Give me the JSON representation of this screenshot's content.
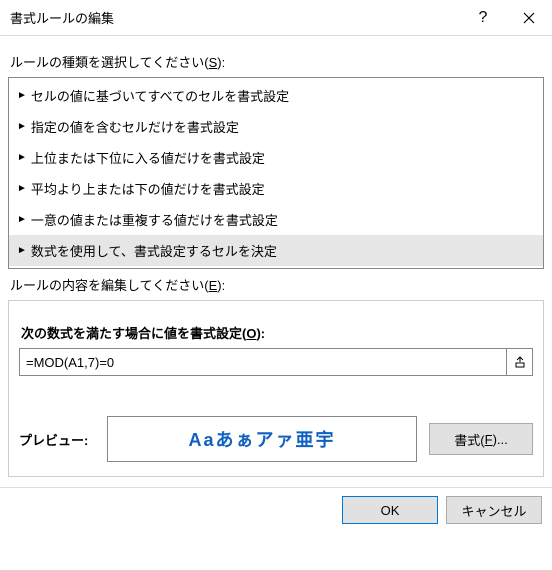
{
  "title": "書式ルールの編集",
  "help_symbol": "?",
  "select_label_pre": "ルールの種類を選択してください(",
  "select_label_key": "S",
  "select_label_post": "):",
  "rules": [
    {
      "label": "セルの値に基づいてすべてのセルを書式設定",
      "selected": false
    },
    {
      "label": "指定の値を含むセルだけを書式設定",
      "selected": false
    },
    {
      "label": "上位または下位に入る値だけを書式設定",
      "selected": false
    },
    {
      "label": "平均より上または下の値だけを書式設定",
      "selected": false
    },
    {
      "label": "一意の値または重複する値だけを書式設定",
      "selected": false
    },
    {
      "label": "数式を使用して、書式設定するセルを決定",
      "selected": true
    }
  ],
  "edit_label_pre": "ルールの内容を編集してください(",
  "edit_label_key": "E",
  "edit_label_post": "):",
  "formula_label_pre": "次の数式を満たす場合に値を書式設定(",
  "formula_label_key": "O",
  "formula_label_post": "):",
  "formula_value": "=MOD(A1,7)=0",
  "preview_label": "プレビュー:",
  "preview_text": "Aaあぁアァ亜宇",
  "preview_color": "#1060c0",
  "format_btn_pre": "書式(",
  "format_btn_key": "F",
  "format_btn_post": ")...",
  "ok_label": "OK",
  "cancel_label": "キャンセル"
}
